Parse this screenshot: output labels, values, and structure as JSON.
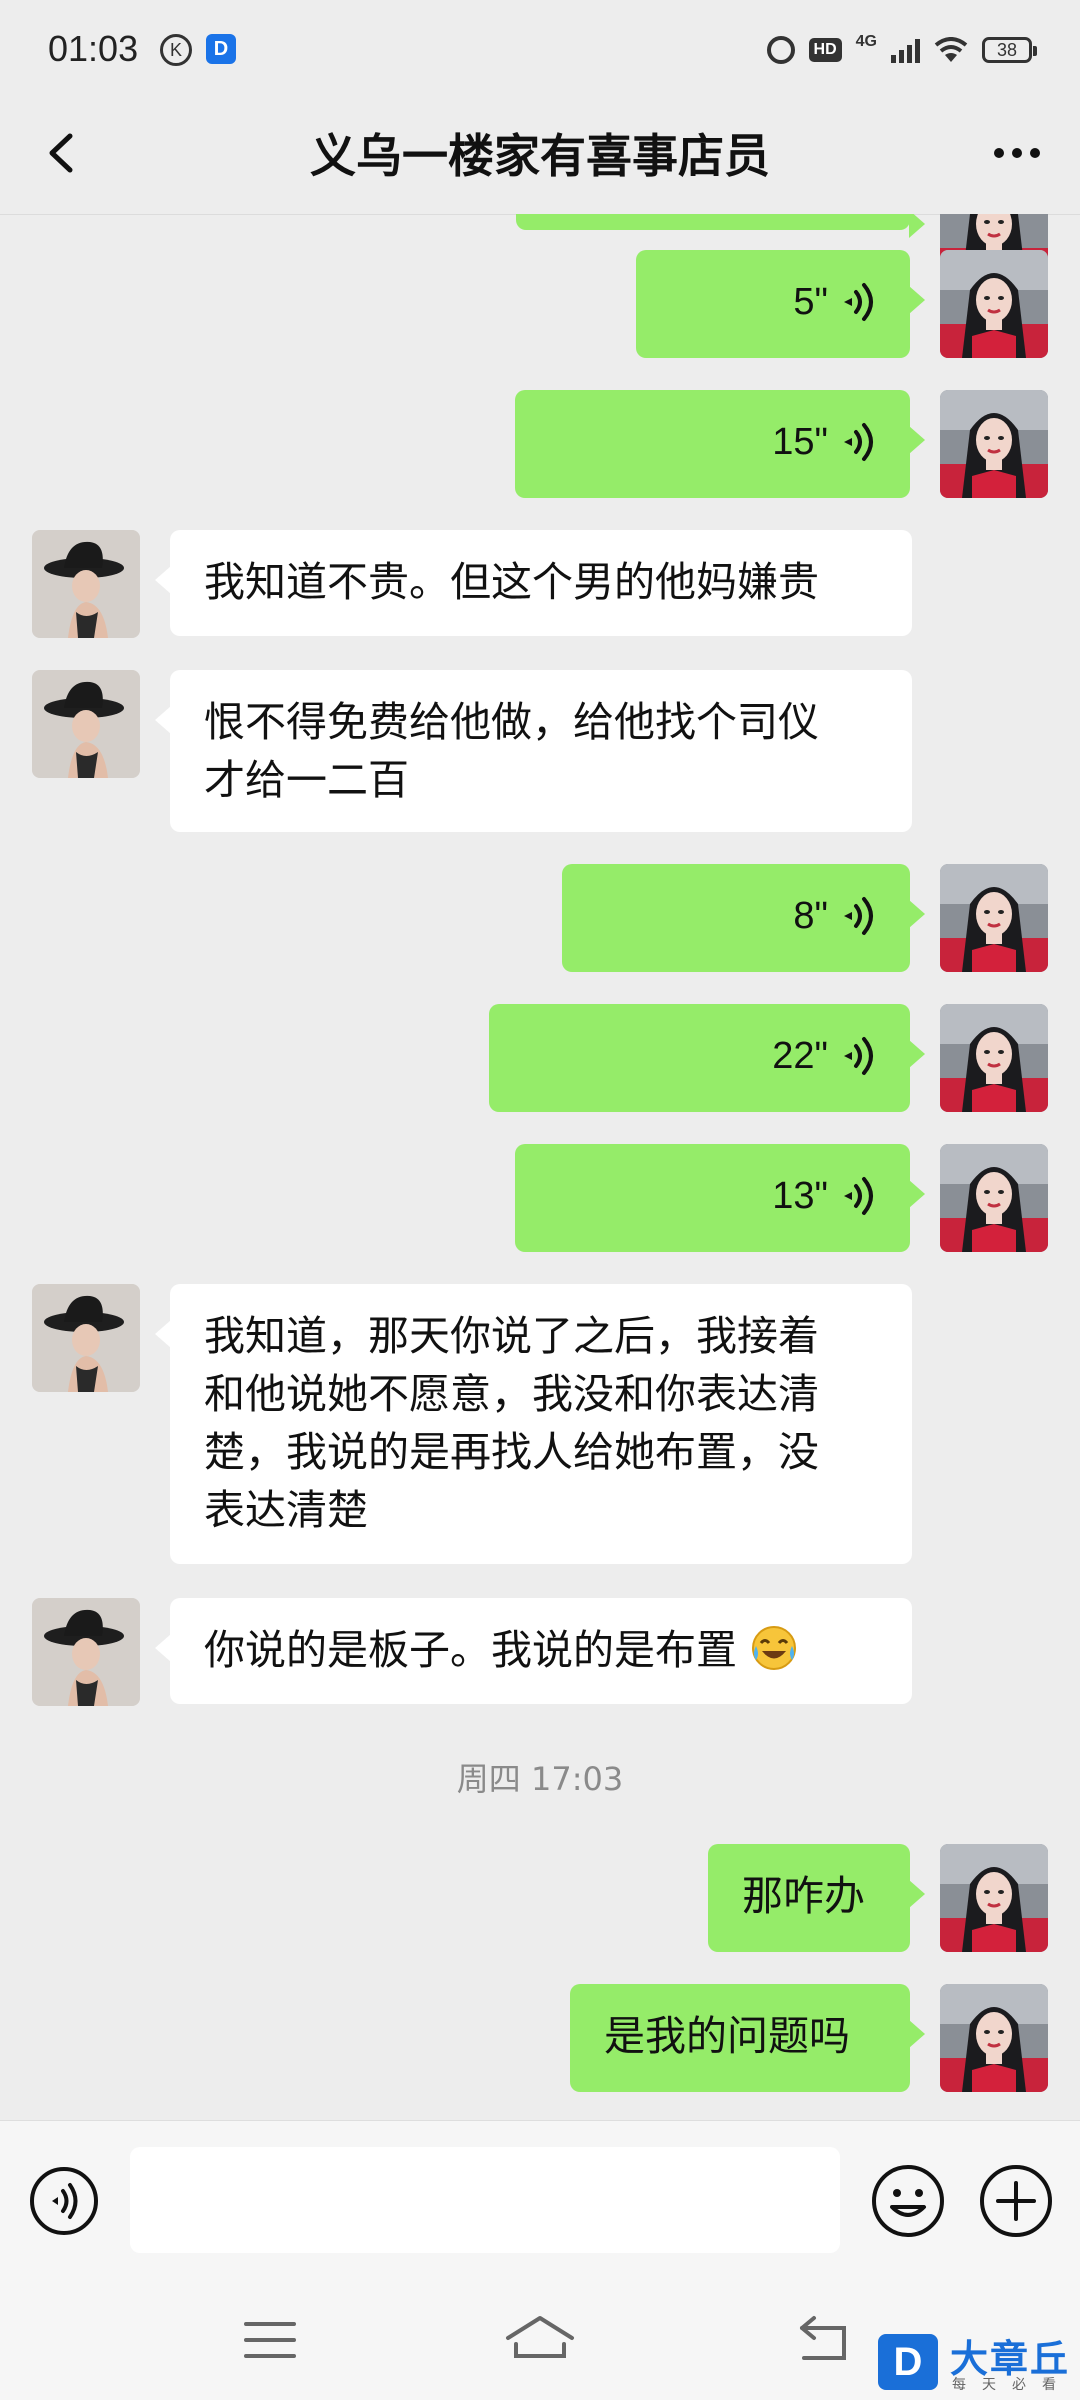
{
  "status_bar": {
    "time": "01:03",
    "k_badge": "K",
    "d_badge": "D",
    "hd": "HD",
    "network": "4G",
    "battery": "38"
  },
  "header": {
    "title": "义乌一楼家有喜事店员"
  },
  "messages": [
    {
      "duration": "5\""
    },
    {
      "duration": "15\""
    },
    {
      "text": "我知道不贵。但这个男的他妈嫌贵"
    },
    {
      "line1": "恨不得免费给他做，给他找个司仪",
      "line2": "才给一二百"
    },
    {
      "duration": "8\""
    },
    {
      "duration": "22\""
    },
    {
      "duration": "13\""
    },
    {
      "line1": "我知道，那天你说了之后，我接着",
      "line2": "和他说她不愿意，我没和你表达清",
      "line3": "楚，我说的是再找人给她布置，没",
      "line4": "表达清楚"
    },
    {
      "text": "你说的是板子。我说的是布置",
      "emoji": "laughing-crying-emoji"
    },
    {
      "text": "那咋办"
    },
    {
      "text": "是我的问题吗"
    }
  ],
  "timestamp": "周四 17:03",
  "input": {
    "value": "",
    "placeholder": ""
  },
  "watermark": {
    "logo": "D",
    "title": "大章丘",
    "subtitle": "每天必看"
  },
  "colors": {
    "background": "#ededed",
    "outgoing_bubble": "#95ec69",
    "incoming_bubble": "#ffffff",
    "watermark_blue": "#1a6fd8"
  }
}
